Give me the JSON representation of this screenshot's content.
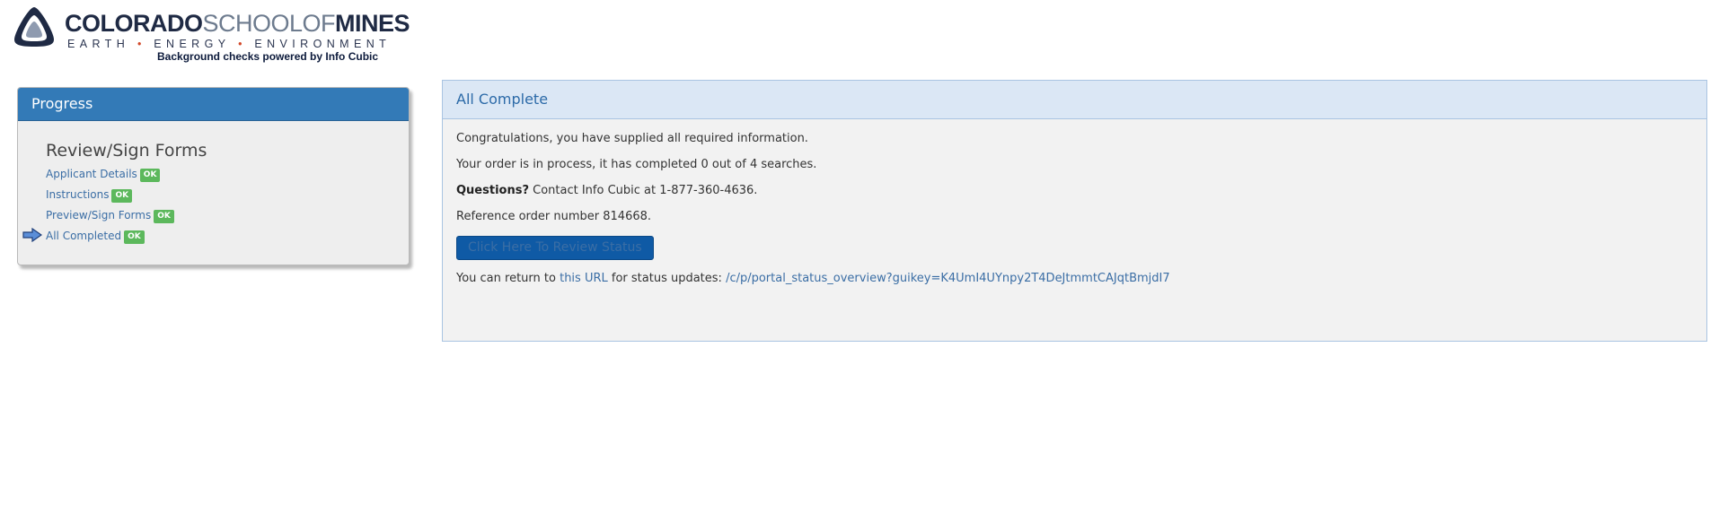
{
  "header": {
    "logo_bold": "COLORADO",
    "logo_light": "SCHOOLOF",
    "logo_bold2": "MINES",
    "logo_sub_words": [
      "EARTH",
      "ENERGY",
      "ENVIRONMENT"
    ],
    "logo_sub_separator": "•",
    "powered_by": "Background checks powered by Info Cubic"
  },
  "progress": {
    "title": "Progress",
    "current_step": "Review/Sign Forms",
    "steps": [
      {
        "label": "Applicant Details",
        "status": "OK"
      },
      {
        "label": "Instructions",
        "status": "OK"
      },
      {
        "label": "Preview/Sign Forms",
        "status": "OK"
      },
      {
        "label": "All Completed",
        "status": "OK"
      }
    ]
  },
  "main": {
    "title": "All Complete",
    "line1": "Congratulations, you have supplied all required information.",
    "line2": "Your order is in process, it has completed 0 out of 4 searches.",
    "questions_label": "Questions?",
    "questions_text": " Contact Info Cubic at 1-877-360-4636.",
    "reference": "Reference order number 814668.",
    "button_label": "Click Here To Review Status",
    "return_prefix": "You can return to ",
    "return_link": "this URL",
    "return_middle": " for status updates: ",
    "status_url": "/c/p/portal_status_overview?guikey=K4UmI4UYnpy2T4DeJtmmtCAJqtBmjdI7"
  },
  "colors": {
    "progress_header": "#337ab7",
    "ok_badge": "#5cb85c",
    "button": "#0f5aa5",
    "link": "#3b6ea5"
  }
}
